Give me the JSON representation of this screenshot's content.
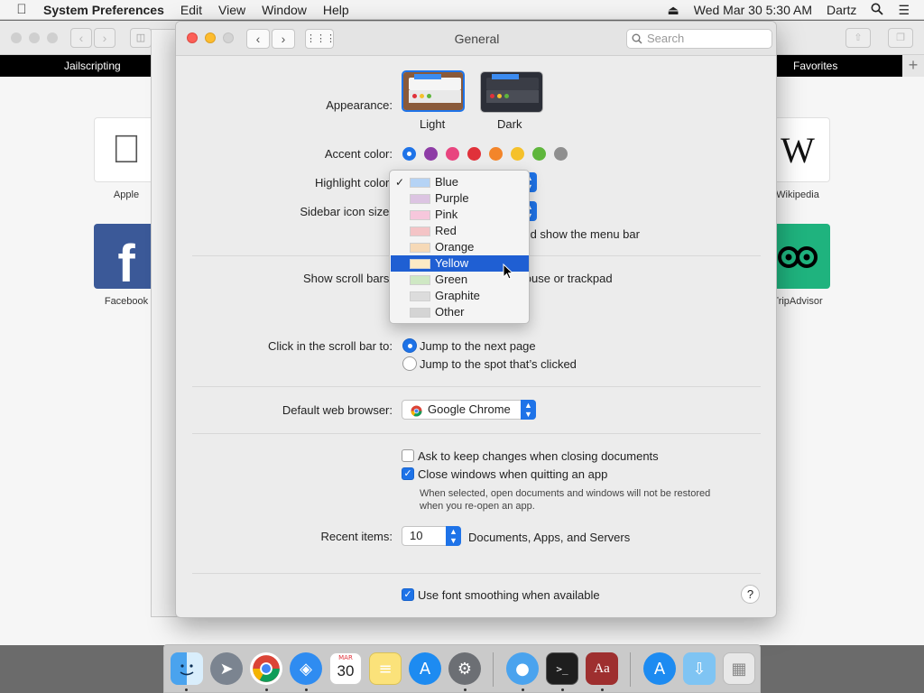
{
  "menubar": {
    "apple_icon": "apple-icon",
    "app_name": "System Preferences",
    "menus": [
      "Edit",
      "View",
      "Window",
      "Help"
    ],
    "datetime": "Wed Mar 30  5:30 AM",
    "user": "Dartz"
  },
  "safari": {
    "tabs": [
      "Jailscripting",
      "Favorites"
    ],
    "favorites": [
      {
        "label": "Apple"
      },
      {
        "label": "Facebook"
      },
      {
        "label": "Wikipedia"
      },
      {
        "label": "TripAdvisor"
      }
    ]
  },
  "prefs": {
    "title": "General",
    "search_placeholder": "Search",
    "appearance": {
      "label": "Appearance:",
      "options": [
        "Light",
        "Dark"
      ],
      "selected": "Light"
    },
    "accent": {
      "label": "Accent color:",
      "colors": [
        "#1e73e8",
        "#8e3ca6",
        "#e8457f",
        "#e0313a",
        "#f3852a",
        "#f5c12b",
        "#5fb63c",
        "#8f8f8f"
      ],
      "selected": 0
    },
    "highlight": {
      "label": "Highlight color:"
    },
    "sidebar_icon": {
      "label": "Sidebar icon size:"
    },
    "menubar_text": "Automatically hide and show the menu bar",
    "scroll_bars": {
      "label": "Show scroll bars:",
      "partial_option": "When scrolling on mouse or trackpad"
    },
    "click_scroll": {
      "label": "Click in the scroll bar to:",
      "options": [
        "Jump to the next page",
        "Jump to the spot that’s clicked"
      ],
      "selected": 0
    },
    "browser": {
      "label": "Default web browser:",
      "value": "Google Chrome"
    },
    "ask_keep": {
      "label": "Ask to keep changes when closing documents",
      "checked": false
    },
    "close_windows": {
      "label": "Close windows when quitting an app",
      "checked": true,
      "note_line1": "When selected, open documents and windows will not be restored",
      "note_line2": "when you re-open an app."
    },
    "recent": {
      "label": "Recent items:",
      "value": "10",
      "suffix": "Documents, Apps, and Servers"
    },
    "font_smoothing": {
      "label": "Use font smoothing when available",
      "checked": true
    },
    "help": "?"
  },
  "highlight_menu": {
    "items": [
      {
        "name": "Blue",
        "swatch": "#b5d3f5"
      },
      {
        "name": "Purple",
        "swatch": "#dcc4e2"
      },
      {
        "name": "Pink",
        "swatch": "#f6c7dc"
      },
      {
        "name": "Red",
        "swatch": "#f4c4c6"
      },
      {
        "name": "Orange",
        "swatch": "#f6d9b7"
      },
      {
        "name": "Yellow",
        "swatch": "#fbeac5"
      },
      {
        "name": "Green",
        "swatch": "#cfe8c4"
      },
      {
        "name": "Graphite",
        "swatch": "#dcdcdc"
      },
      {
        "name": "Other",
        "swatch": "#d4d4d4"
      }
    ],
    "checked": "Blue",
    "hovered": "Yellow",
    "check_glyph": "✓"
  },
  "dock": {
    "calendar_month": "MAR",
    "calendar_day": "30"
  }
}
